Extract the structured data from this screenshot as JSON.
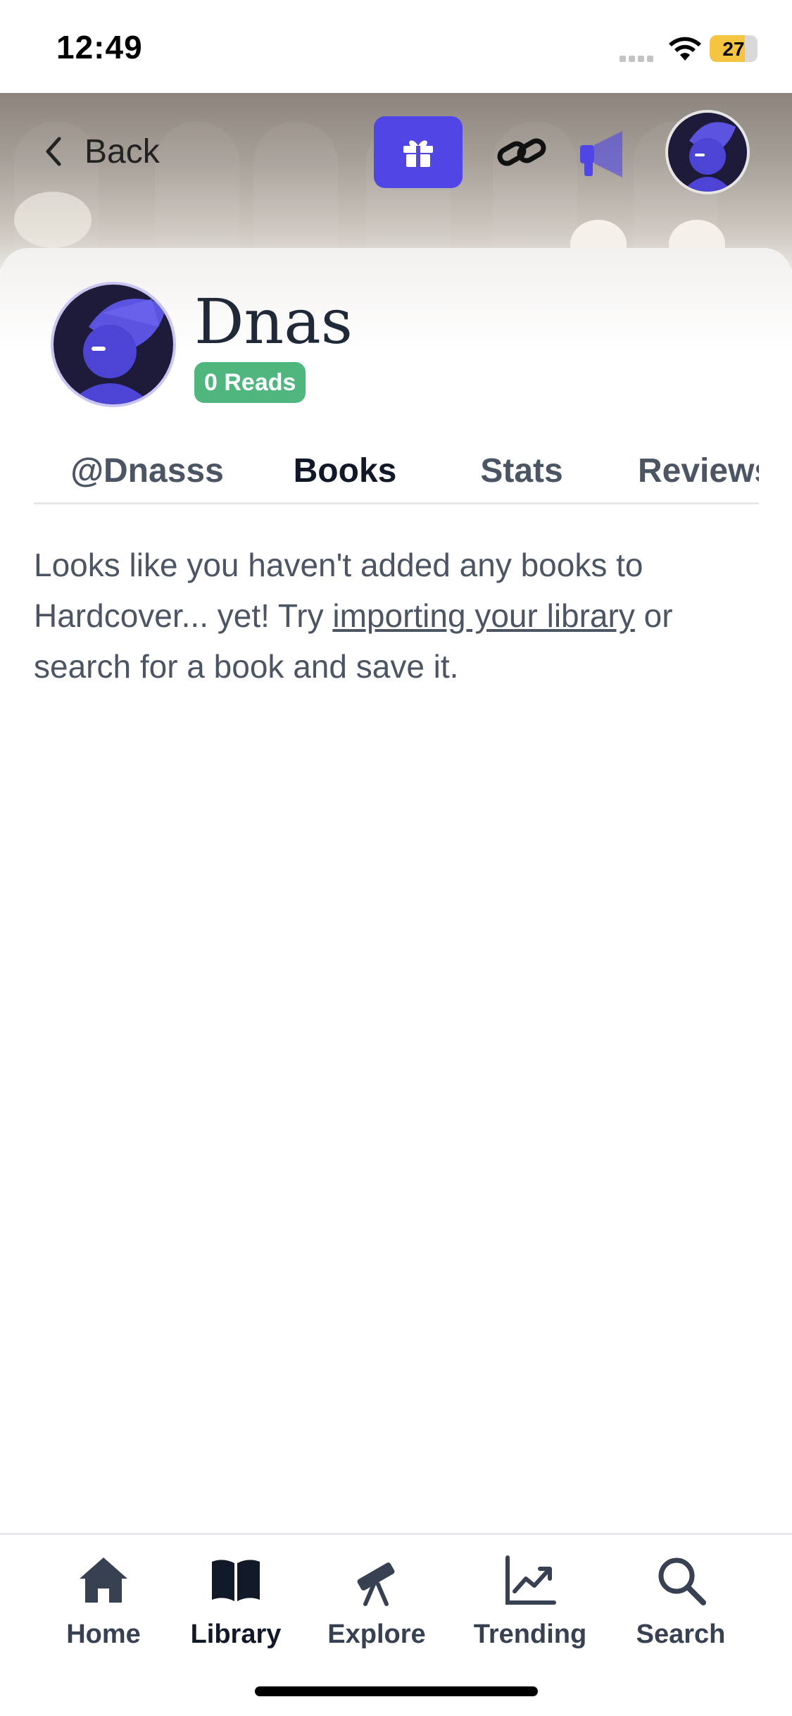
{
  "status_bar": {
    "time": "12:49",
    "battery": "27"
  },
  "header": {
    "back_label": "Back",
    "icons": [
      "gift-icon",
      "link-icon",
      "megaphone-icon",
      "avatar"
    ]
  },
  "profile": {
    "name": "Dnas",
    "reads_badge": "0 Reads"
  },
  "tabs": [
    {
      "label": "@Dnasss"
    },
    {
      "label": "Books",
      "active": true
    },
    {
      "label": "Stats"
    },
    {
      "label": "Reviews"
    }
  ],
  "empty_state": {
    "text_before": "Looks like you haven't added any books to Hardcover... yet! Try ",
    "link": "importing your library",
    "text_after": " or search for a book and save it."
  },
  "bottom_nav": {
    "items": [
      {
        "label": "Home",
        "icon": "home-icon"
      },
      {
        "label": "Library",
        "icon": "book-icon",
        "active": true
      },
      {
        "label": "Explore",
        "icon": "telescope-icon"
      },
      {
        "label": "Trending",
        "icon": "trending-icon"
      },
      {
        "label": "Search",
        "icon": "search-icon"
      }
    ]
  },
  "colors": {
    "accent": "#4f46e5",
    "badge_green": "#4fb77e",
    "text_muted": "#4b5563"
  }
}
